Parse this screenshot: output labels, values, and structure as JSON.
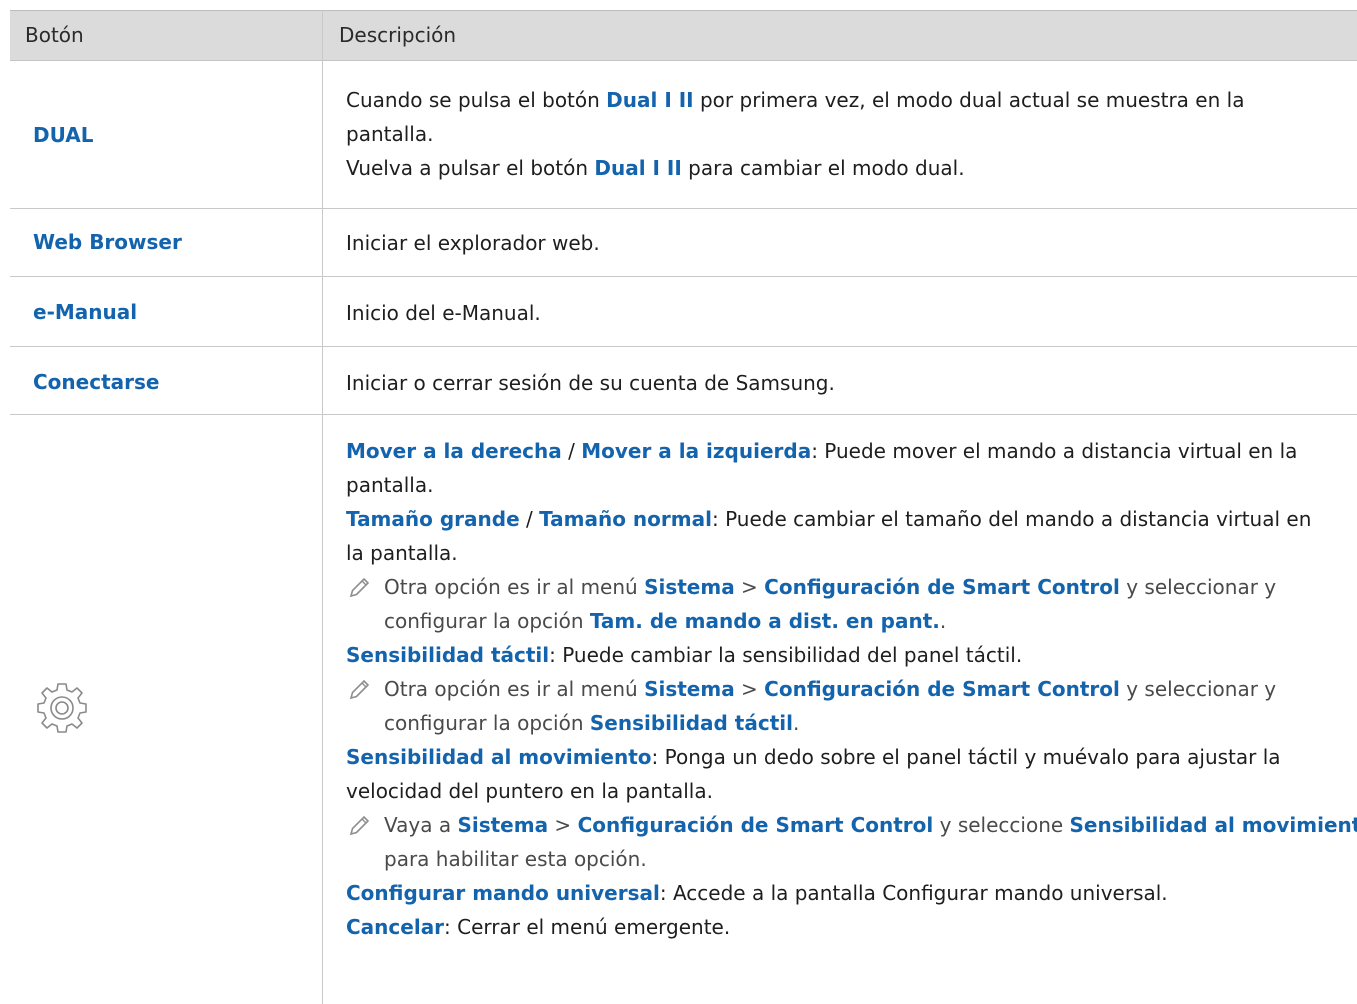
{
  "header": {
    "col_button": "Botón",
    "col_description": "Descripción"
  },
  "rows": {
    "dual": {
      "label": "DUAL",
      "l1_a": "Cuando se pulsa el botón ",
      "l1_kw": "Dual I II",
      "l1_b": " por primera vez, el modo dual actual se muestra en la",
      "l2": "pantalla.",
      "l3_a": "Vuelva a pulsar el botón ",
      "l3_kw": "Dual I II",
      "l3_b": " para cambiar el modo dual."
    },
    "web": {
      "label": "Web Browser",
      "desc": "Iniciar el explorador web."
    },
    "manual": {
      "label": "e-Manual",
      "desc": "Inicio del e-Manual."
    },
    "connect": {
      "label": "Conectarse",
      "desc": "Iniciar o cerrar sesión de su cuenta de Samsung."
    },
    "settings": {
      "icon": "gear-icon",
      "a_kw1": "Mover a la derecha",
      "a_sep": " / ",
      "a_kw2": "Mover a la izquierda",
      "a_rest": ": Puede mover el mando a distancia virtual en la",
      "a_cont": "pantalla.",
      "b_kw1": "Tamaño grande",
      "b_sep": " / ",
      "b_kw2": "Tamaño normal",
      "b_rest": ": Puede cambiar el tamaño del mando a distancia virtual en",
      "b_cont": "la pantalla.",
      "n1_a": "Otra opción es ir al menú ",
      "n1_kw1": "Sistema",
      "n1_gt": " > ",
      "n1_kw2": "Configuración de Smart Control",
      "n1_b": " y seleccionar y",
      "n1_c": "configurar la opción ",
      "n1_kw3": "Tam. de mando a dist. en pant.",
      "n1_d": ".",
      "c_kw": "Sensibilidad táctil",
      "c_rest": ": Puede cambiar la sensibilidad del panel táctil.",
      "n2_a": "Otra opción es ir al menú ",
      "n2_kw1": "Sistema",
      "n2_gt": " > ",
      "n2_kw2": "Configuración de Smart Control",
      "n2_b": " y seleccionar y",
      "n2_c": "configurar la opción ",
      "n2_kw3": "Sensibilidad táctil",
      "n2_d": ".",
      "d_kw": "Sensibilidad al movimiento",
      "d_rest": ": Ponga un dedo sobre el panel táctil y muévalo para ajustar la",
      "d_cont": "velocidad del puntero en la pantalla.",
      "n3_a": "Vaya a ",
      "n3_kw1": "Sistema",
      "n3_gt": " > ",
      "n3_kw2": "Configuración de Smart Control",
      "n3_b": " y seleccione ",
      "n3_kw3": "Sensibilidad al movimiento",
      "n3_c": "para habilitar esta opción.",
      "e_kw": "Configurar mando universal",
      "e_rest": ": Accede a la pantalla Configurar mando universal.",
      "f_kw": "Cancelar",
      "f_rest": ": Cerrar el menú emergente."
    }
  },
  "colors": {
    "keyword": "#1464ad",
    "header_bg": "#dbdbdb",
    "border": "#c8c8c8"
  }
}
